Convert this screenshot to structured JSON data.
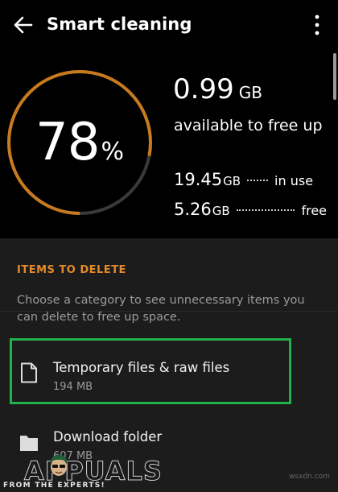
{
  "header": {
    "title": "Smart cleaning",
    "back_icon": "arrow-left-icon",
    "menu_icon": "more-vertical-icon"
  },
  "gauge": {
    "percent_value": "78",
    "percent_sign": "%",
    "fraction": 0.78,
    "track_color": "#3a3a3a",
    "fill_color": "#c77a1e"
  },
  "summary": {
    "free_value": "0.99",
    "free_unit": "GB",
    "free_label": "available to free up",
    "in_use_value": "19.45",
    "in_use_unit": "GB",
    "in_use_label": "in use",
    "free_space_value": "5.26",
    "free_space_unit": "GB",
    "free_space_label": "free"
  },
  "items_section": {
    "title": "ITEMS TO DELETE",
    "description": "Choose a category to see unnecessary items you can delete to free up space.",
    "accent_color": "#e48a2a"
  },
  "items": [
    {
      "name": "Temporary files & raw files",
      "size": "194 MB",
      "icon": "file-icon"
    },
    {
      "name": "Download folder",
      "size": "607 MB",
      "icon": "folder-icon"
    }
  ],
  "highlight_color": "#22b24c",
  "watermark": {
    "brand": "APPUALS",
    "tagline": "FROM THE EXPERTS!",
    "site": "wsxdn.com"
  }
}
